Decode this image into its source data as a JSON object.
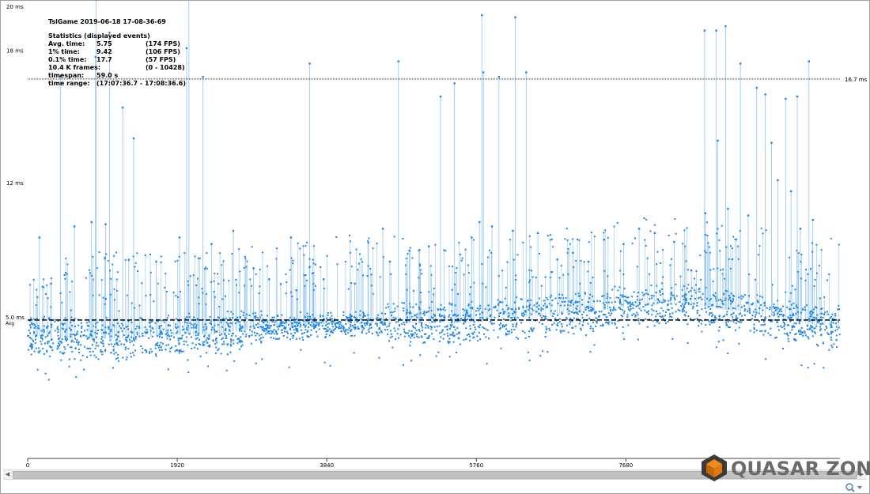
{
  "window": {
    "background": "#ffffff"
  },
  "stats": {
    "title": "TslGame 2019-06-18 17-08-36-69",
    "heading": "Statistics (displayed events)",
    "rows": [
      {
        "label": "Avg. time:",
        "value": "5.75",
        "extra": "(174 FPS)"
      },
      {
        "label": "1% time:",
        "value": "9.42",
        "extra": "(106 FPS)"
      },
      {
        "label": "0.1% time:",
        "value": "17.7",
        "extra": "(57 FPS)"
      },
      {
        "label": "10.4 K frames:",
        "value": "",
        "extra": "(0 - 10428)"
      },
      {
        "label": "timespan:",
        "value": "59.0 s",
        "extra": ""
      },
      {
        "label": "time range:",
        "value": "(17:07:36.7 - 17:08:36.6)",
        "extra": ""
      }
    ]
  },
  "chart_data": {
    "type": "scatter",
    "title": "TslGame 2019-06-18 17-08-36-69",
    "xlabel": "",
    "ylabel": "",
    "xlim": [
      0,
      10428
    ],
    "ylim": [
      0,
      20
    ],
    "x_ticks": [
      0,
      1920,
      3840,
      5760,
      7680
    ],
    "x_tick_labels": [
      "0",
      "1920",
      "3840",
      "5760",
      "7680"
    ],
    "y_ticks": [
      12,
      18,
      20
    ],
    "y_tick_labels": [
      "12 ms",
      "18 ms",
      "20 ms"
    ],
    "average": {
      "value": 5.75,
      "label": "5.0 ms",
      "sublabel": "Avg"
    },
    "threshold": {
      "value": 16.7,
      "label": "16.7 ms"
    },
    "marker_color": "#1e87e5",
    "line_color": "#8fc3f2",
    "grid": false,
    "legend": "none",
    "series": [
      {
        "baseline": [
          [
            0,
            5.1
          ],
          [
            400,
            4.9
          ],
          [
            800,
            4.9
          ],
          [
            1200,
            4.9
          ],
          [
            1600,
            5.0
          ],
          [
            2000,
            5.1
          ],
          [
            2400,
            5.1
          ],
          [
            2800,
            5.3
          ],
          [
            3200,
            5.4
          ],
          [
            3600,
            5.5
          ],
          [
            4000,
            5.6
          ],
          [
            4400,
            5.6
          ],
          [
            4800,
            5.6
          ],
          [
            5200,
            5.6
          ],
          [
            5600,
            5.6
          ],
          [
            6000,
            5.8
          ],
          [
            6400,
            5.9
          ],
          [
            6800,
            6.0
          ],
          [
            7200,
            6.1
          ],
          [
            7600,
            6.3
          ],
          [
            8000,
            6.4
          ],
          [
            8400,
            6.5
          ],
          [
            8800,
            6.3
          ],
          [
            9200,
            6.1
          ],
          [
            9600,
            5.9
          ],
          [
            10000,
            5.6
          ],
          [
            10428,
            5.4
          ]
        ],
        "spikes": [
          [
            150,
            9.5
          ],
          [
            300,
            7.4
          ],
          [
            420,
            16.8
          ],
          [
            600,
            10.0
          ],
          [
            820,
            10.2
          ],
          [
            870,
            17.7
          ],
          [
            880,
            20.3
          ],
          [
            1000,
            10.1
          ],
          [
            1050,
            18.8
          ],
          [
            1220,
            15.4
          ],
          [
            1360,
            14.0
          ],
          [
            1650,
            8.4
          ],
          [
            1950,
            9.5
          ],
          [
            2040,
            18.1
          ],
          [
            2070,
            20.6
          ],
          [
            2250,
            16.8
          ],
          [
            2360,
            9.2
          ],
          [
            2640,
            9.8
          ],
          [
            2900,
            8.1
          ],
          [
            3100,
            7.6
          ],
          [
            3380,
            9.5
          ],
          [
            3450,
            7.1
          ],
          [
            3620,
            17.4
          ],
          [
            3800,
            7.6
          ],
          [
            4200,
            7.4
          ],
          [
            4560,
            9.9
          ],
          [
            4650,
            8.4
          ],
          [
            4760,
            17.5
          ],
          [
            4900,
            8.9
          ],
          [
            5150,
            9.1
          ],
          [
            5300,
            15.9
          ],
          [
            5480,
            16.5
          ],
          [
            5700,
            9.5
          ],
          [
            5800,
            10.2
          ],
          [
            5830,
            19.6
          ],
          [
            5850,
            17.0
          ],
          [
            5960,
            10.0
          ],
          [
            6050,
            16.8
          ],
          [
            6230,
            9.8
          ],
          [
            6260,
            19.5
          ],
          [
            6400,
            17.0
          ],
          [
            6550,
            9.7
          ],
          [
            6800,
            8.5
          ],
          [
            7000,
            8.8
          ],
          [
            7200,
            8.4
          ],
          [
            7400,
            9.4
          ],
          [
            7650,
            9.2
          ],
          [
            7850,
            9.9
          ],
          [
            8050,
            9.7
          ],
          [
            8300,
            9.3
          ],
          [
            8520,
            8.0
          ],
          [
            8690,
            18.9
          ],
          [
            8700,
            10.6
          ],
          [
            8840,
            18.9
          ],
          [
            8860,
            13.9
          ],
          [
            8960,
            19.1
          ],
          [
            8990,
            10.8
          ],
          [
            9150,
            17.4
          ],
          [
            9250,
            10.5
          ],
          [
            9360,
            16.3
          ],
          [
            9470,
            16.0
          ],
          [
            9550,
            13.8
          ],
          [
            9630,
            12.1
          ],
          [
            9730,
            15.8
          ],
          [
            9800,
            11.6
          ],
          [
            9880,
            15.9
          ],
          [
            9920,
            9.9
          ],
          [
            10030,
            17.5
          ],
          [
            10080,
            10.3
          ]
        ]
      }
    ]
  }
}
